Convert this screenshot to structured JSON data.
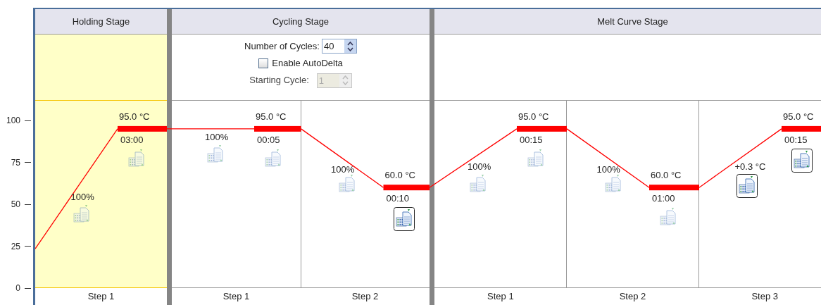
{
  "axis": {
    "ticks": [
      "100",
      "75",
      "50",
      "25",
      "0"
    ]
  },
  "stages": [
    {
      "title": "Holding Stage",
      "selected": true,
      "steps": [
        {
          "label": "Step 1",
          "temperature": "95.0 °C",
          "time": "03:00",
          "ramp": "100%",
          "ramp_collect": false,
          "hold_collect": false
        }
      ]
    },
    {
      "title": "Cycling Stage",
      "selected": false,
      "settings": {
        "cycles_label": "Number of Cycles:",
        "cycles": "40",
        "autodelta_label": "Enable AutoDelta",
        "autodelta_checked": false,
        "starting_label": "Starting Cycle:",
        "starting": "1",
        "starting_disabled": true
      },
      "steps": [
        {
          "label": "Step 1",
          "temperature": "95.0 °C",
          "time": "00:05",
          "ramp": "100%",
          "ramp_collect": false,
          "hold_collect": false
        },
        {
          "label": "Step 2",
          "temperature": "60.0 °C",
          "time": "00:10",
          "ramp": "100%",
          "ramp_collect": false,
          "hold_collect": true
        }
      ]
    },
    {
      "title": "Melt Curve Stage",
      "selected": false,
      "steps": [
        {
          "label": "Step 1",
          "temperature": "95.0 °C",
          "time": "00:15",
          "ramp": "100%",
          "ramp_collect": false,
          "hold_collect": false
        },
        {
          "label": "Step 2",
          "temperature": "60.0 °C",
          "time": "01:00",
          "ramp": "100%",
          "ramp_collect": false,
          "hold_collect": false
        },
        {
          "label": "Step 3",
          "temperature": "95.0 °C",
          "time": "00:15",
          "ramp": "+0.3 °C",
          "ramp_collect": true,
          "hold_collect": true
        }
      ]
    }
  ]
}
